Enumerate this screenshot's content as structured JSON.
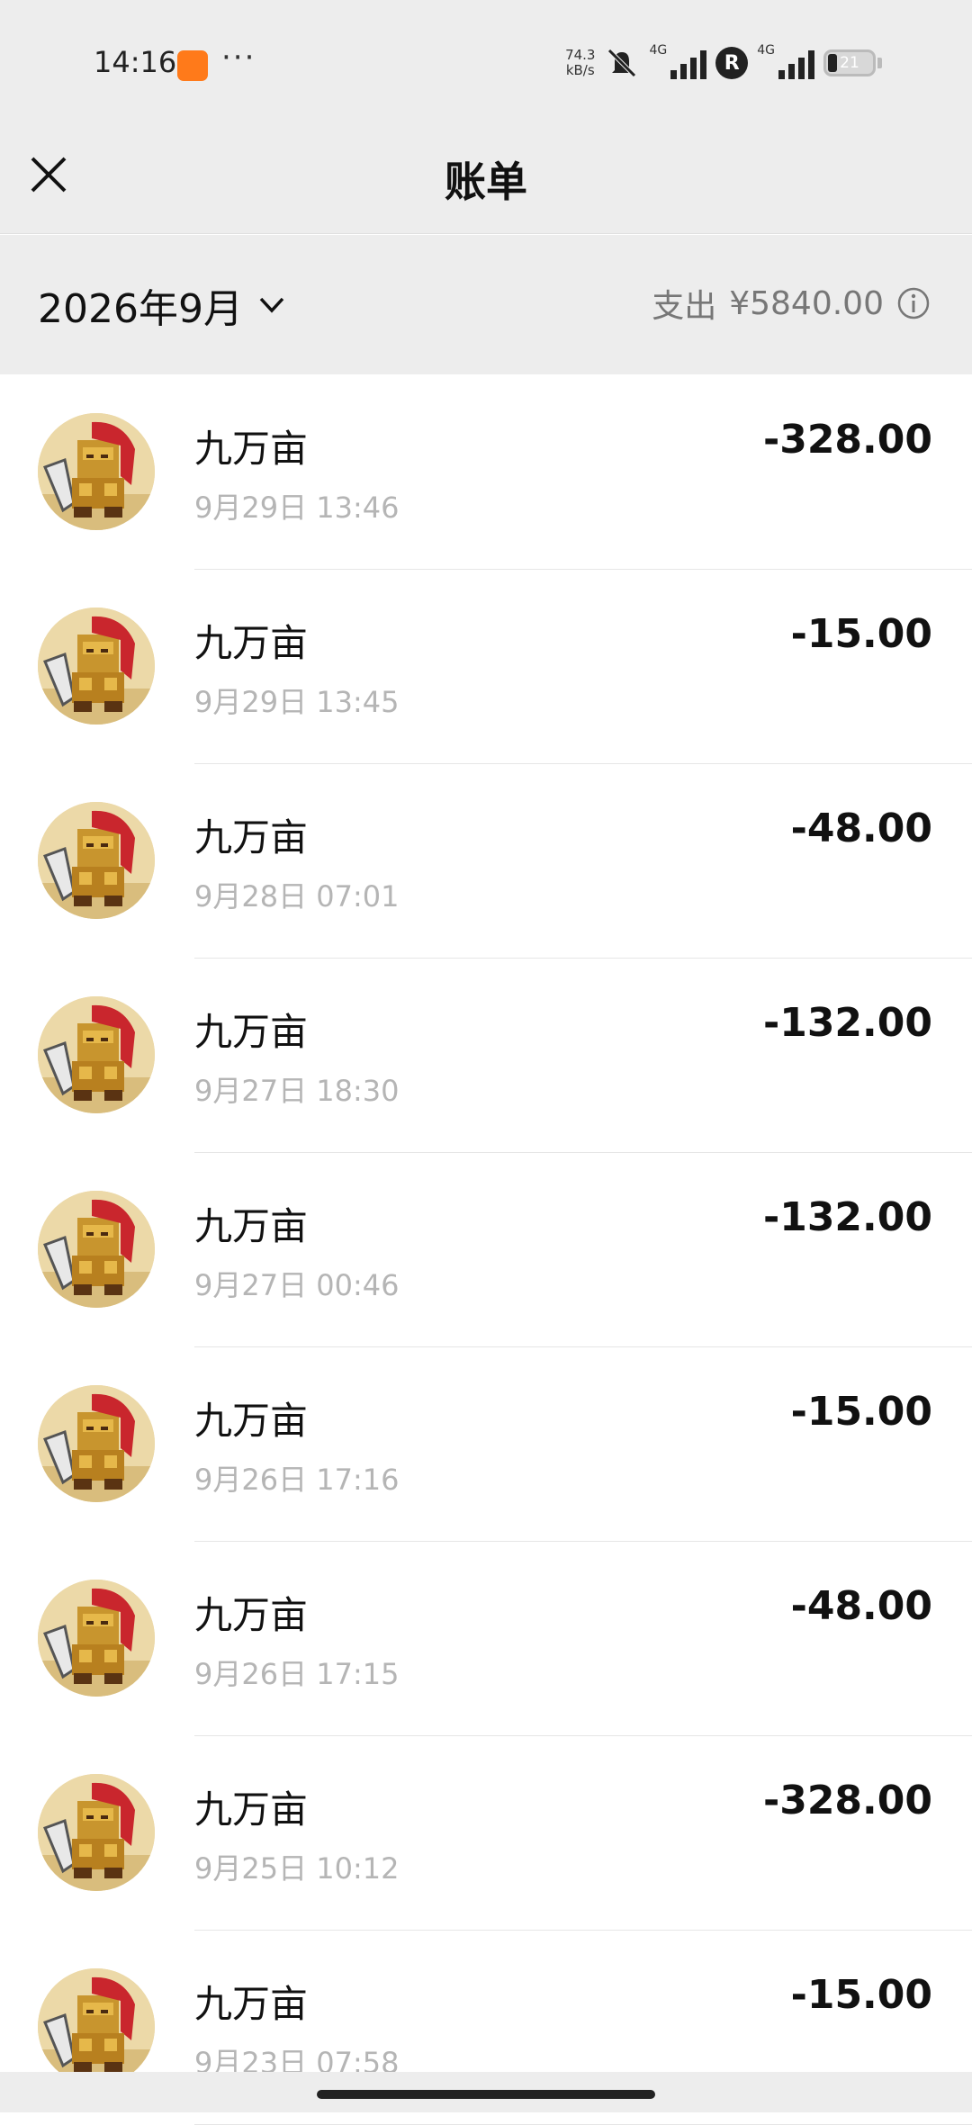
{
  "status_bar": {
    "time": "14:16",
    "more": "···",
    "net_speed_value": "74.3",
    "net_speed_unit": "kB/s",
    "net1": "4G",
    "net2": "4G",
    "roaming": "R",
    "battery": "21"
  },
  "nav": {
    "title": "账单"
  },
  "filter": {
    "month": "2026年9月",
    "summary_label": "支出",
    "summary_value": "¥5840.00"
  },
  "transactions": [
    {
      "merchant": "九万亩",
      "time": "9月29日 13:46",
      "amount": "-328.00"
    },
    {
      "merchant": "九万亩",
      "time": "9月29日 13:45",
      "amount": "-15.00"
    },
    {
      "merchant": "九万亩",
      "time": "9月28日 07:01",
      "amount": "-48.00"
    },
    {
      "merchant": "九万亩",
      "time": "9月27日 18:30",
      "amount": "-132.00"
    },
    {
      "merchant": "九万亩",
      "time": "9月27日 00:46",
      "amount": "-132.00"
    },
    {
      "merchant": "九万亩",
      "time": "9月26日 17:16",
      "amount": "-15.00"
    },
    {
      "merchant": "九万亩",
      "time": "9月26日 17:15",
      "amount": "-48.00"
    },
    {
      "merchant": "九万亩",
      "time": "9月25日 10:12",
      "amount": "-328.00"
    },
    {
      "merchant": "九万亩",
      "time": "9月23日 07:58",
      "amount": "-15.00"
    }
  ]
}
